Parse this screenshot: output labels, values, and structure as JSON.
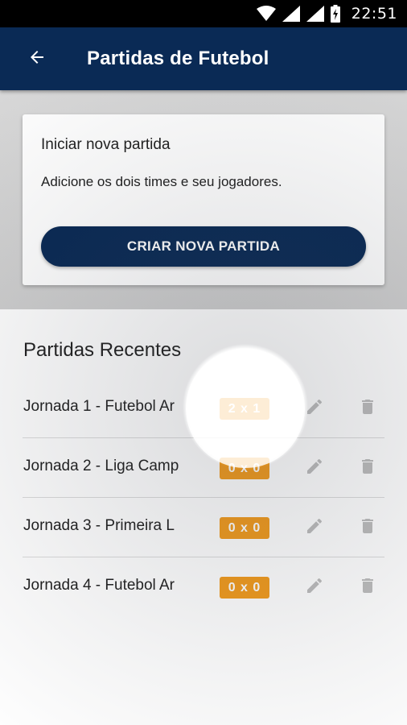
{
  "status_bar": {
    "time": "22:51",
    "icons": [
      "wifi-icon",
      "signal-icon",
      "signal-icon",
      "battery-charging-icon"
    ]
  },
  "app_bar": {
    "title": "Partidas de Futebol",
    "back_icon": "arrow-back-icon"
  },
  "new_match_card": {
    "title": "Iniciar nova partida",
    "subtitle": "Adicione os dois times e seu jogadores.",
    "button_label": "CRIAR NOVA PARTIDA"
  },
  "recent": {
    "title": "Partidas Recentes",
    "matches": [
      {
        "name": "Jornada 1 - Futebol Ar",
        "score": "2 x 1"
      },
      {
        "name": "Jornada 2 - Liga Camp",
        "score": "0 x 0"
      },
      {
        "name": "Jornada 3 - Primeira L",
        "score": "0 x 0"
      },
      {
        "name": "Jornada 4 - Futebol Ar",
        "score": "0 x 0"
      }
    ]
  },
  "colors": {
    "primary": "#0a2a55",
    "badge": "#f29b1d",
    "icon_gray": "#bdbdbd"
  }
}
